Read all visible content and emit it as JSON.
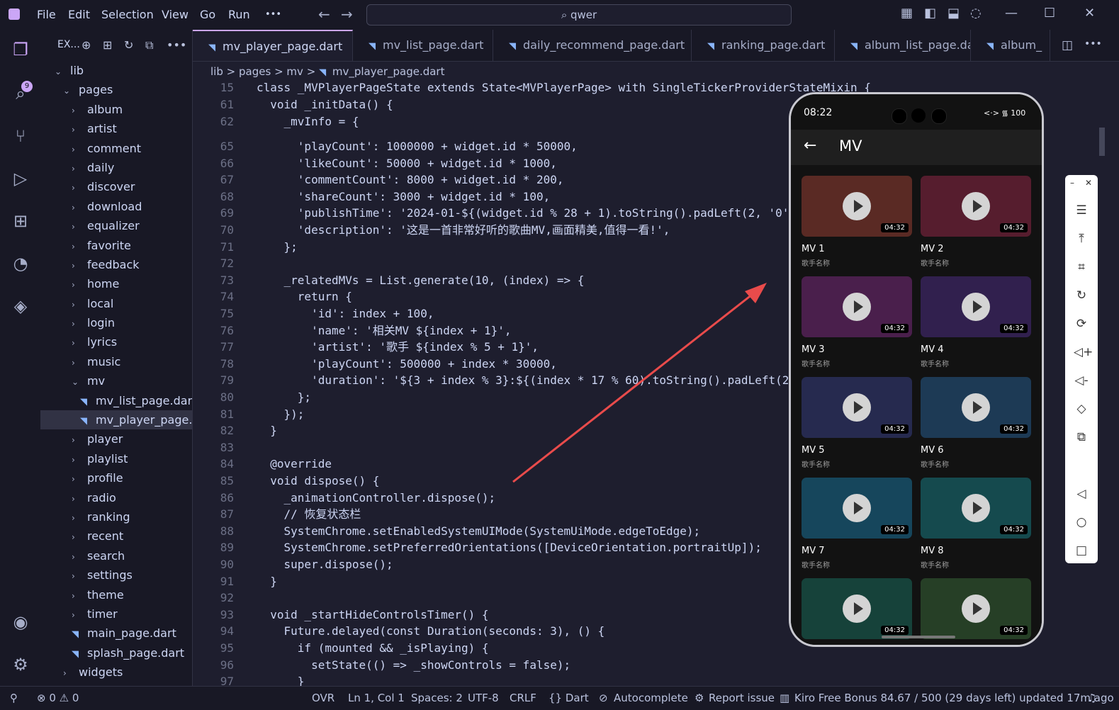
{
  "menu": [
    "File",
    "Edit",
    "Selection",
    "View",
    "Go",
    "Run",
    "•••"
  ],
  "search": "qwer",
  "activity_badge": "9",
  "explorer": {
    "title": "EX...",
    "tree": [
      {
        "label": "lib",
        "indent": 0,
        "type": "folder-open"
      },
      {
        "label": "pages",
        "indent": 1,
        "type": "folder-open"
      },
      {
        "label": "album",
        "indent": 2,
        "type": "folder"
      },
      {
        "label": "artist",
        "indent": 2,
        "type": "folder"
      },
      {
        "label": "comment",
        "indent": 2,
        "type": "folder"
      },
      {
        "label": "daily",
        "indent": 2,
        "type": "folder"
      },
      {
        "label": "discover",
        "indent": 2,
        "type": "folder"
      },
      {
        "label": "download",
        "indent": 2,
        "type": "folder"
      },
      {
        "label": "equalizer",
        "indent": 2,
        "type": "folder"
      },
      {
        "label": "favorite",
        "indent": 2,
        "type": "folder"
      },
      {
        "label": "feedback",
        "indent": 2,
        "type": "folder"
      },
      {
        "label": "home",
        "indent": 2,
        "type": "folder"
      },
      {
        "label": "local",
        "indent": 2,
        "type": "folder"
      },
      {
        "label": "login",
        "indent": 2,
        "type": "folder"
      },
      {
        "label": "lyrics",
        "indent": 2,
        "type": "folder"
      },
      {
        "label": "music",
        "indent": 2,
        "type": "folder"
      },
      {
        "label": "mv",
        "indent": 2,
        "type": "folder-open"
      },
      {
        "label": "mv_list_page.dart",
        "indent": 3,
        "type": "file"
      },
      {
        "label": "mv_player_page.d...",
        "indent": 3,
        "type": "file",
        "selected": true
      },
      {
        "label": "player",
        "indent": 2,
        "type": "folder"
      },
      {
        "label": "playlist",
        "indent": 2,
        "type": "folder"
      },
      {
        "label": "profile",
        "indent": 2,
        "type": "folder"
      },
      {
        "label": "radio",
        "indent": 2,
        "type": "folder"
      },
      {
        "label": "ranking",
        "indent": 2,
        "type": "folder"
      },
      {
        "label": "recent",
        "indent": 2,
        "type": "folder"
      },
      {
        "label": "search",
        "indent": 2,
        "type": "folder"
      },
      {
        "label": "settings",
        "indent": 2,
        "type": "folder"
      },
      {
        "label": "theme",
        "indent": 2,
        "type": "folder"
      },
      {
        "label": "timer",
        "indent": 2,
        "type": "folder"
      },
      {
        "label": "main_page.dart",
        "indent": 2,
        "type": "file"
      },
      {
        "label": "splash_page.dart",
        "indent": 2,
        "type": "file"
      },
      {
        "label": "widgets",
        "indent": 1,
        "type": "folder"
      }
    ]
  },
  "tabs": [
    {
      "label": "mv_player_page.dart",
      "active": true
    },
    {
      "label": "mv_list_page.dart"
    },
    {
      "label": "daily_recommend_page.dart"
    },
    {
      "label": "ranking_page.dart"
    },
    {
      "label": "album_list_page.dart"
    },
    {
      "label": "album_"
    }
  ],
  "breadcrumb": [
    "lib",
    ">",
    "pages",
    ">",
    "mv",
    ">",
    "mv_player_page.dart"
  ],
  "code_lines": [
    {
      "n": "15",
      "t": "class _MVPlayerPageState extends State<MVPlayerPage> with SingleTickerProviderStateMixin {"
    },
    {
      "n": "61",
      "t": "  void _initData() {"
    },
    {
      "n": "62",
      "t": "    _mvInfo = {"
    },
    {
      "n": "65",
      "t": "      'playCount': 1000000 + widget.id * 50000,"
    },
    {
      "n": "66",
      "t": "      'likeCount': 50000 + widget.id * 1000,"
    },
    {
      "n": "67",
      "t": "      'commentCount': 8000 + widget.id * 200,"
    },
    {
      "n": "68",
      "t": "      'shareCount': 3000 + widget.id * 100,"
    },
    {
      "n": "69",
      "t": "      'publishTime': '2024-01-${(widget.id % 28 + 1).toString().padLeft(2, '0'"
    },
    {
      "n": "70",
      "t": "      'description': '这是一首非常好听的歌曲MV,画面精美,值得一看!',"
    },
    {
      "n": "71",
      "t": "    };"
    },
    {
      "n": "72",
      "t": ""
    },
    {
      "n": "73",
      "t": "    _relatedMVs = List.generate(10, (index) => {"
    },
    {
      "n": "74",
      "t": "      return {"
    },
    {
      "n": "75",
      "t": "        'id': index + 100,"
    },
    {
      "n": "76",
      "t": "        'name': '相关MV ${index + 1}',"
    },
    {
      "n": "77",
      "t": "        'artist': '歌手 ${index % 5 + 1}',"
    },
    {
      "n": "78",
      "t": "        'playCount': 500000 + index * 30000,"
    },
    {
      "n": "79",
      "t": "        'duration': '${3 + index % 3}:${(index * 17 % 60).toString().padLeft(2"
    },
    {
      "n": "80",
      "t": "      };"
    },
    {
      "n": "81",
      "t": "    });"
    },
    {
      "n": "82",
      "t": "  }"
    },
    {
      "n": "83",
      "t": ""
    },
    {
      "n": "84",
      "t": "  @override"
    },
    {
      "n": "85",
      "t": "  void dispose() {"
    },
    {
      "n": "86",
      "t": "    _animationController.dispose();"
    },
    {
      "n": "87",
      "t": "    // 恢复状态栏"
    },
    {
      "n": "88",
      "t": "    SystemChrome.setEnabledSystemUIMode(SystemUiMode.edgeToEdge);"
    },
    {
      "n": "89",
      "t": "    SystemChrome.setPreferredOrientations([DeviceOrientation.portraitUp]);"
    },
    {
      "n": "90",
      "t": "    super.dispose();"
    },
    {
      "n": "91",
      "t": "  }"
    },
    {
      "n": "92",
      "t": ""
    },
    {
      "n": "93",
      "t": "  void _startHideControlsTimer() {"
    },
    {
      "n": "94",
      "t": "    Future.delayed(const Duration(seconds: 3), () {"
    },
    {
      "n": "95",
      "t": "      if (mounted && _isPlaying) {"
    },
    {
      "n": "96",
      "t": "        setState(() => _showControls = false);"
    },
    {
      "n": "97",
      "t": "      }"
    }
  ],
  "phone": {
    "time": "08:22",
    "status_icons": "<·> ᯾ 100",
    "title": "MV",
    "cards": [
      {
        "name": "MV 1",
        "artist": "歌手名称",
        "duration": "04:32",
        "color": "#5a2a24"
      },
      {
        "name": "MV 2",
        "artist": "歌手名称",
        "duration": "04:32",
        "color": "#561d2e"
      },
      {
        "name": "MV 3",
        "artist": "歌手名称",
        "duration": "04:32",
        "color": "#4a1f4c"
      },
      {
        "name": "MV 4",
        "artist": "歌手名称",
        "duration": "04:32",
        "color": "#31204e"
      },
      {
        "name": "MV 5",
        "artist": "歌手名称",
        "duration": "04:32",
        "color": "#262a4f"
      },
      {
        "name": "MV 6",
        "artist": "歌手名称",
        "duration": "04:32",
        "color": "#1d3a55"
      },
      {
        "name": "MV 7",
        "artist": "歌手名称",
        "duration": "04:32",
        "color": "#16465c"
      },
      {
        "name": "MV 8",
        "artist": "歌手名称",
        "duration": "04:32",
        "color": "#154a4e"
      },
      {
        "name": "",
        "artist": "",
        "duration": "04:32",
        "color": "#16423a"
      },
      {
        "name": "",
        "artist": "",
        "duration": "04:32",
        "color": "#263f26"
      }
    ]
  },
  "statusbar": {
    "errors": "⊗ 0 ⚠ 0",
    "ovr": "OVR",
    "position": "Ln 1, Col 1",
    "spaces": "Spaces: 2",
    "encoding": "UTF-8",
    "eol": "CRLF",
    "language": "{} Dart",
    "autocomplete": "Autocomplete",
    "report": "Report issue",
    "kiro": "Kiro Free Bonus 84.67 / 500 (29 days left) updated 17m ago"
  },
  "colors": {
    "accent": "#cba6f7",
    "arrow": "#e94b4b",
    "bg": "#1e1e2e"
  }
}
